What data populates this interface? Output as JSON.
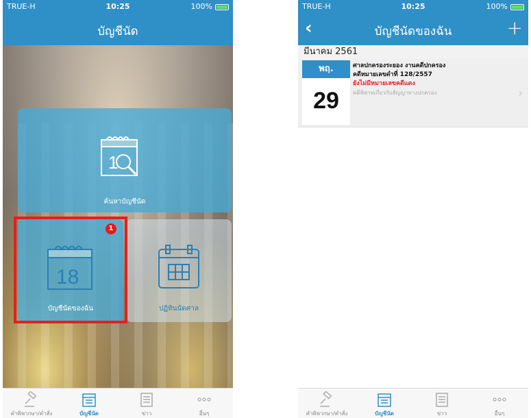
{
  "left_screen": {
    "status_bar": {
      "carrier": "TRUE-H",
      "time": "10:25",
      "battery": "100%"
    },
    "nav": {
      "title": "บัญชีนัด"
    },
    "tiles": {
      "search": {
        "label": "ค้นหาบัญชีนัด",
        "icon_day": "1"
      },
      "my_appointments": {
        "label": "บัญชีนัดของฉัน",
        "icon_day": "18",
        "badge": "1"
      },
      "court_calendar": {
        "label": "ปฏิทินนัดศาล"
      }
    },
    "tab_bar": {
      "items": [
        {
          "label": "คำพิพากษา/คำสั่ง",
          "icon": "gavel-icon"
        },
        {
          "label": "บัญชีนัด",
          "icon": "calendar-icon",
          "active": true
        },
        {
          "label": "ข่าว",
          "icon": "news-icon"
        },
        {
          "label": "อื่นๆ",
          "icon": "more-icon"
        }
      ]
    }
  },
  "right_screen": {
    "status_bar": {
      "carrier": "TRUE-H",
      "time": "10:25",
      "battery": "100%"
    },
    "nav": {
      "title": "บัญชีนัดของฉัน",
      "add": "+"
    },
    "month_header": "มีนาคม 2561",
    "appointment": {
      "weekday": "พฤ.",
      "day": "29",
      "court": "ศาลปกครองระยอง งานคดีปกครอง",
      "case_number": "คดีหมายเลขดำที่ 128/2557",
      "status": "ยังไม่มีหมายเลขคดีแดง",
      "description": "คดีพิพาทเกี่ยวกับสัญญาทางปกครอง"
    },
    "tab_bar": {
      "items": [
        {
          "label": "คำพิพากษา/คำสั่ง",
          "icon": "gavel-icon"
        },
        {
          "label": "บัญชีนัด",
          "icon": "calendar-icon",
          "active": true
        },
        {
          "label": "ข่าว",
          "icon": "news-icon"
        },
        {
          "label": "อื่นๆ",
          "icon": "more-icon"
        }
      ]
    }
  },
  "colors": {
    "primary": "#2f8fc7",
    "highlight": "#e41f1f",
    "status_red": "#e32020",
    "tile": "#46aad7"
  }
}
